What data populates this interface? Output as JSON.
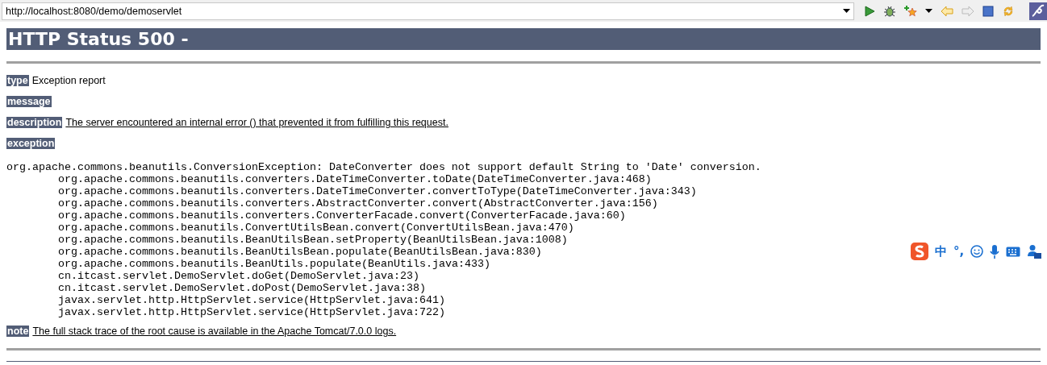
{
  "address_bar": {
    "url": "http://localhost:8080/demo/demoservlet"
  },
  "page": {
    "title": "HTTP Status 500 -",
    "fields": [
      {
        "label": "type",
        "text": "Exception report",
        "kind": "plain"
      },
      {
        "label": "message"
      },
      {
        "label": "description",
        "text": "The server encountered an internal error () that prevented it from fulfilling this request.",
        "kind": "underlined"
      },
      {
        "label": "exception"
      }
    ],
    "exception": {
      "message": "org.apache.commons.beanutils.ConversionException: DateConverter does not support default String to 'Date' conversion.",
      "frames": [
        "org.apache.commons.beanutils.converters.DateTimeConverter.toDate(DateTimeConverter.java:468)",
        "org.apache.commons.beanutils.converters.DateTimeConverter.convertToType(DateTimeConverter.java:343)",
        "org.apache.commons.beanutils.converters.AbstractConverter.convert(AbstractConverter.java:156)",
        "org.apache.commons.beanutils.converters.ConverterFacade.convert(ConverterFacade.java:60)",
        "org.apache.commons.beanutils.ConvertUtilsBean.convert(ConvertUtilsBean.java:470)",
        "org.apache.commons.beanutils.BeanUtilsBean.setProperty(BeanUtilsBean.java:1008)",
        "org.apache.commons.beanutils.BeanUtilsBean.populate(BeanUtilsBean.java:830)",
        "org.apache.commons.beanutils.BeanUtils.populate(BeanUtils.java:433)",
        "cn.itcast.servlet.DemoServlet.doGet(DemoServlet.java:23)",
        "cn.itcast.servlet.DemoServlet.doPost(DemoServlet.java:38)",
        "javax.servlet.http.HttpServlet.service(HttpServlet.java:641)",
        "javax.servlet.http.HttpServlet.service(HttpServlet.java:722)"
      ]
    },
    "note": {
      "label": "note",
      "text": "The full stack trace of the root cause is available in the Apache Tomcat/7.0.0 logs."
    }
  },
  "ime_toolbar": {
    "mode": "中",
    "punctuation": "°,"
  }
}
